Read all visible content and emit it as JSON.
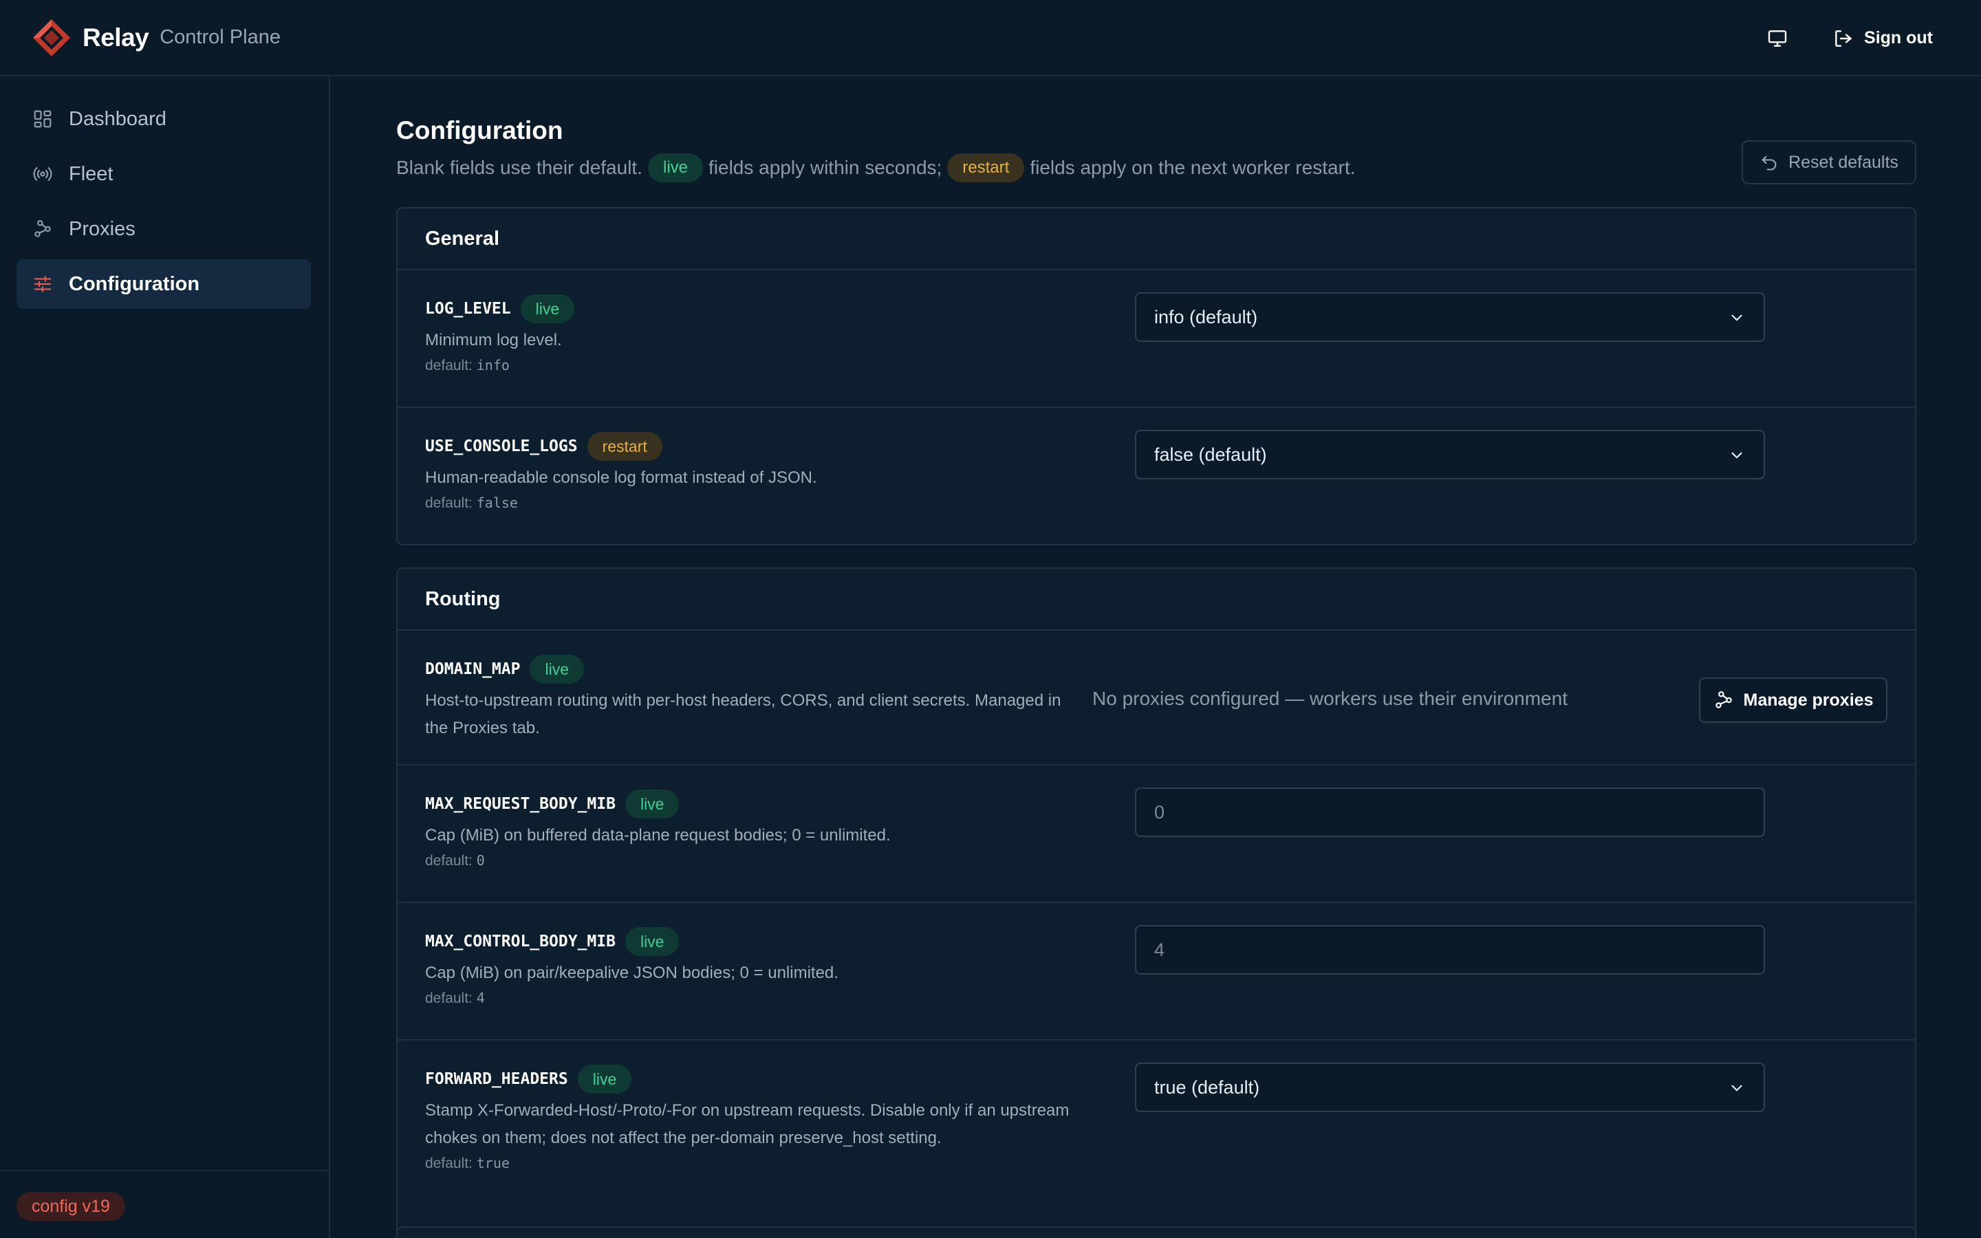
{
  "app": {
    "name": "Relay",
    "subtitle": "Control Plane"
  },
  "header": {
    "sign_out_label": "Sign out",
    "display_icon": "monitor-icon",
    "sign_out_icon": "sign-out-icon"
  },
  "sidebar": {
    "items": [
      {
        "label": "Dashboard",
        "icon": "dashboard-grid-icon",
        "active": false
      },
      {
        "label": "Fleet",
        "icon": "broadcast-icon",
        "active": false
      },
      {
        "label": "Proxies",
        "icon": "proxies-network-icon",
        "active": false
      },
      {
        "label": "Configuration",
        "icon": "sliders-icon",
        "active": true
      }
    ],
    "footer_badge": "config v19"
  },
  "page": {
    "title": "Configuration",
    "desc_part1": "Blank fields use their default.",
    "live_pill": "live",
    "desc_part2": "fields apply within seconds;",
    "restart_pill": "restart",
    "desc_part3": "fields apply on the next worker restart.",
    "reset_label": "Reset defaults"
  },
  "sections": {
    "general": {
      "title": "General",
      "rows": [
        {
          "key": "LOG_LEVEL",
          "mode": "live",
          "desc": "Minimum log level.",
          "default_prefix": "default:",
          "default_value": "info",
          "control_value": "info (default)"
        },
        {
          "key": "USE_CONSOLE_LOGS",
          "mode": "restart",
          "desc": "Human-readable console log format instead of JSON.",
          "default_prefix": "default:",
          "default_value": "false",
          "control_value": "false (default)"
        }
      ]
    },
    "routing": {
      "title": "Routing",
      "rows": [
        {
          "key": "DOMAIN_MAP",
          "mode": "live",
          "desc_line1": "Host-to-upstream routing with per-host headers, CORS, and client secrets. Managed in",
          "desc_line2": "the Proxies tab.",
          "status_text": "No proxies configured — workers use their environment",
          "button_label": "Manage proxies"
        },
        {
          "key": "MAX_REQUEST_BODY_MIB",
          "mode": "live",
          "desc": "Cap (MiB) on buffered data-plane request bodies; 0 = unlimited.",
          "default_prefix": "default:",
          "default_value": "0",
          "control_value": "0"
        },
        {
          "key": "MAX_CONTROL_BODY_MIB",
          "mode": "live",
          "desc": "Cap (MiB) on pair/keepalive JSON bodies; 0 = unlimited.",
          "default_prefix": "default:",
          "default_value": "4",
          "control_value": "4"
        },
        {
          "key": "FORWARD_HEADERS",
          "mode": "live",
          "desc_line1": "Stamp X-Forwarded-Host/-Proto/-For on upstream requests. Disable only if an upstream",
          "desc_line2": "chokes on them; does not affect the per-domain preserve_host setting.",
          "default_prefix": "default:",
          "default_value": "true",
          "control_value": "true (default)"
        }
      ]
    }
  },
  "colors": {
    "background": "#0b1a28",
    "accent_live": "#3fd196",
    "accent_restart": "#e6b23c",
    "brand": "#d94a3b"
  }
}
